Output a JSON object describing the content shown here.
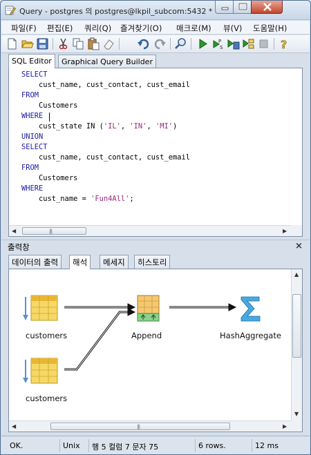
{
  "window": {
    "title": "Query - postgres 의 postgres@lkpil_subcom:5432 *"
  },
  "menu": {
    "items": [
      "파일(F)",
      "편집(E)",
      "쿼리(Q)",
      "즐겨찾기(O)",
      "매크로(M)",
      "뷰(V)",
      "도움말(H)"
    ]
  },
  "toolbar": {
    "icons": [
      "new-file-icon",
      "open-folder-icon",
      "save-icon",
      "cut-icon",
      "copy-icon",
      "paste-icon",
      "eraser-icon",
      "undo-icon",
      "redo-icon",
      "find-icon",
      "execute-icon",
      "execute-pgscript-icon",
      "execute-to-file-icon",
      "explain-icon",
      "stop-icon",
      "help-icon"
    ]
  },
  "editor": {
    "tabs": [
      "SQL Editor",
      "Graphical Query Builder"
    ],
    "active_tab": "SQL Editor",
    "code_lines": [
      {
        "kw": "SELECT",
        "text": ""
      },
      {
        "kw": "",
        "text": "    cust_name, cust_contact, cust_email"
      },
      {
        "kw": "FROM",
        "text": ""
      },
      {
        "kw": "",
        "text": "    Customers"
      },
      {
        "kw": "WHERE",
        "text": ""
      },
      {
        "kw": "",
        "text": "    cust_state IN (",
        "strings": [
          "'IL'",
          "'IN'",
          "'MI'"
        ]
      },
      {
        "kw": "UNION",
        "text": ""
      },
      {
        "kw": "SELECT",
        "text": ""
      },
      {
        "kw": "",
        "text": "    cust_name, cust_contact, cust_email"
      },
      {
        "kw": "FROM",
        "text": ""
      },
      {
        "kw": "",
        "text": "    Customers"
      },
      {
        "kw": "WHERE",
        "text": ""
      },
      {
        "kw": "",
        "text": "    cust_name = ",
        "strings": [
          "'Fun4All'"
        ]
      }
    ]
  },
  "output": {
    "title": "출력창",
    "close_symbol": "×",
    "tabs": [
      "데이터의 출력",
      "해석",
      "메세지",
      "히스토리"
    ],
    "active_tab": "해석",
    "explain_nodes": {
      "scan1": "customers",
      "scan2": "customers",
      "append": "Append",
      "aggregate": "HashAggregate"
    }
  },
  "status": {
    "state": "OK.",
    "line_ending": "Unix",
    "position": "행 5 컬럼 7 문자 75",
    "rows": "6 rows.",
    "time": "12 ms"
  },
  "colors": {
    "keyword": "#1a1aa6",
    "string": "#9c2a7c",
    "run_green": "#2a9a2a"
  }
}
